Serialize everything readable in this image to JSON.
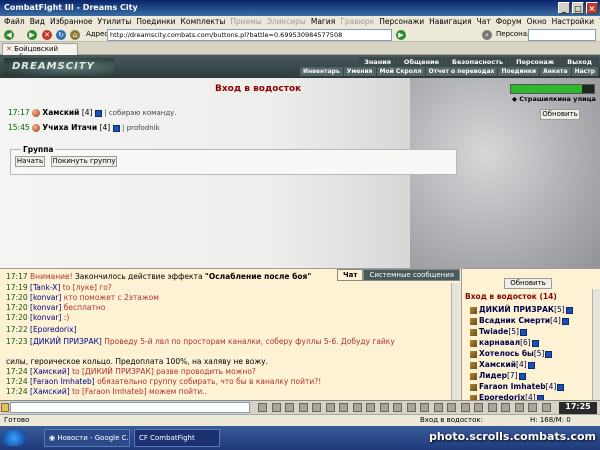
{
  "window": {
    "title": "CombatFight III - Dreams City",
    "app_icon": "CF"
  },
  "menu": [
    "Файл",
    "Вид",
    "Избранное",
    "Утилиты",
    "Поединки",
    "Комплекты",
    "Приемы",
    "Эликсиры",
    "Магия",
    "Гравюрк",
    "Персонажи",
    "Навигация",
    "Чат",
    "Форум",
    "Окно",
    "Настройки",
    "?"
  ],
  "menu_dim": [
    6,
    7,
    9
  ],
  "address": {
    "label": "Адрес:",
    "url": "http://dreamscity.combats.com/buttons.pl?battle=0.699530984577508",
    "persona_label": "Персонаж:"
  },
  "tab": {
    "label": "Бойцовский клуб"
  },
  "game": {
    "logo": "DREAMSCITY",
    "topnav": [
      "Знания",
      "Общение",
      "Безопасность",
      "Персонаж",
      "Выход"
    ],
    "subnav": [
      "Инвентарь",
      "Умения",
      "Мой Скролл",
      "Отчет о переводах",
      "Поединки",
      "Анкета",
      "Настр"
    ]
  },
  "room": {
    "title": "Вход в водосток",
    "players": [
      {
        "time": "17:17",
        "nick": "Хамский",
        "level": "[4]",
        "status": "собираю команду."
      },
      {
        "time": "15:45",
        "nick": "Учиха Итачи",
        "level": "[4]",
        "status": "profodnik"
      }
    ],
    "group": {
      "legend": "Группа",
      "start_button": "Начать",
      "join_button": "Покинуть группу"
    },
    "location": "Страшилкина улица",
    "refresh_button": "Обновить"
  },
  "chat": {
    "tabs": [
      "Чат",
      "Системные сообщения"
    ],
    "lines": [
      {
        "time": "17:17",
        "warn": "Внимание!",
        "text": "Закончилось действие эффекта ",
        "bold": "\"Ослабление после боя\""
      },
      {
        "time": "17:19",
        "from": "[Tank-X]",
        "text": "to [луке] го?"
      },
      {
        "time": "17:20",
        "from": "[konvar]",
        "text": "кто поможет с 2этажом"
      },
      {
        "time": "17:20",
        "from": "[konvar]",
        "text": "бесплатно"
      },
      {
        "time": "17:20",
        "from": "[konvar]",
        "text": ":)"
      },
      {
        "time": "17:22",
        "from": "[Eporedorix]",
        "text": ""
      },
      {
        "time": "17:23",
        "from": "[ДИКИЙ ПРИЗРАК]",
        "text": "Проведу 5-й лвл по просторам каналки, соберу фуллы 5-6. Добуду гайку"
      },
      {
        "time": "",
        "from": "",
        "text": "силы, героическое кольцо. Предоплата 100%, на халяву не вожу."
      },
      {
        "time": "17:24",
        "from": "[Хамский]",
        "text": "to [ДИКИЙ ПРИЗРАК] разве проводить можно?"
      },
      {
        "time": "17:24",
        "from": "[Faraon Imhateb]",
        "text": "обязательно группу собирать, что бы в каналку пойти?!"
      },
      {
        "time": "17:24",
        "from": "[Хамский]",
        "text": "to [Faraon Imhateb] можем пойти.."
      }
    ]
  },
  "online": {
    "refresh_button": "Обновить",
    "title": "Вход в водосток (14)",
    "users": [
      {
        "nick": "ДИКИЙ ПРИЗРАК",
        "level": "[5]"
      },
      {
        "nick": "Всадник Смерти",
        "level": "[4]"
      },
      {
        "nick": "Twiade",
        "level": "[5]"
      },
      {
        "nick": "карнавал",
        "level": "[6]"
      },
      {
        "nick": "Хотелось бы",
        "level": "[5]"
      },
      {
        "nick": "Хамский",
        "level": "[4]"
      },
      {
        "nick": "Лидер",
        "level": "[7]"
      },
      {
        "nick": "Faraon Imhateb",
        "level": "[4]"
      },
      {
        "nick": "Eporedorix",
        "level": "[4]"
      }
    ]
  },
  "hp": {
    "text": "",
    "fill_fraction": 0.85
  },
  "clock": "17:25",
  "status": {
    "ready": "Готово",
    "room": "Вход в водосток:",
    "hp": "H: 168/M: 0"
  },
  "taskbar": {
    "tasks": [
      "Новости - Google C...",
      "CF CombatFight"
    ],
    "watermark": "photo.scrolls.combats.com"
  },
  "colors": {
    "accent_red": "#8b0000",
    "chat_bg": "#fdf3d4",
    "header": "#2c3a3c"
  }
}
